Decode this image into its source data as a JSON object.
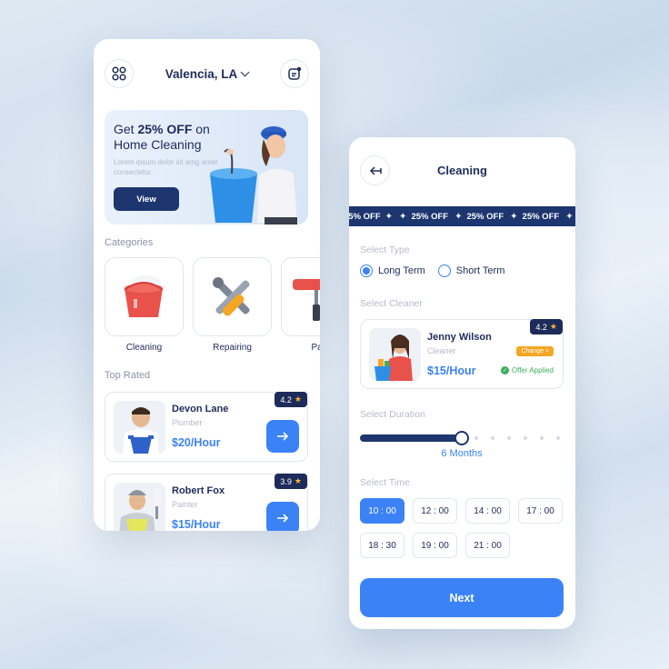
{
  "home": {
    "location": "Valencia, LA",
    "promo": {
      "title_prefix": "Get",
      "title_highlight": "25% OFF",
      "title_mid": "on",
      "title_line2": "Home Cleaning",
      "description": "Lorem ipsum dolor sit amg amet consectetur.",
      "button": "View"
    },
    "categories_title": "Categories",
    "categories": [
      {
        "label": "Cleaning",
        "icon": "bucket-icon"
      },
      {
        "label": "Repairing",
        "icon": "tools-icon"
      },
      {
        "label": "Pain",
        "icon": "paint-roller-icon"
      }
    ],
    "top_rated_title": "Top Rated",
    "workers": [
      {
        "name": "Devon Lane",
        "role": "Plumber",
        "price": "$20/Hour",
        "rating": "4.2"
      },
      {
        "name": "Robert Fox",
        "role": "Painter",
        "price": "$15/Hour",
        "rating": "3.9"
      }
    ]
  },
  "booking": {
    "title": "Cleaning",
    "ticker_text": "25% OFF",
    "select_type_label": "Select Type",
    "types": [
      {
        "label": "Long Term",
        "selected": true
      },
      {
        "label": "Short Term",
        "selected": false
      }
    ],
    "select_cleaner_label": "Select Cleaner",
    "cleaner": {
      "name": "Jenny Wilson",
      "role": "Cleaner",
      "price": "$15/Hour",
      "rating": "4.2",
      "change": "Change >",
      "offer": "Offer Applied"
    },
    "select_duration_label": "Select Duration",
    "duration": {
      "value": "6 Months",
      "fraction": 0.5
    },
    "select_time_label": "Select Time",
    "times": [
      "10 : 00",
      "12 : 00",
      "14 : 00",
      "17 : 00",
      "18 : 30",
      "19 : 00",
      "21 : 00"
    ],
    "selected_time_index": 0,
    "next_button": "Next"
  },
  "colors": {
    "navy": "#1d2b5a",
    "accent_blue": "#3b82f6",
    "star": "#f6b533",
    "change_orange": "#f6a623",
    "offer_green": "#3dae5c"
  }
}
